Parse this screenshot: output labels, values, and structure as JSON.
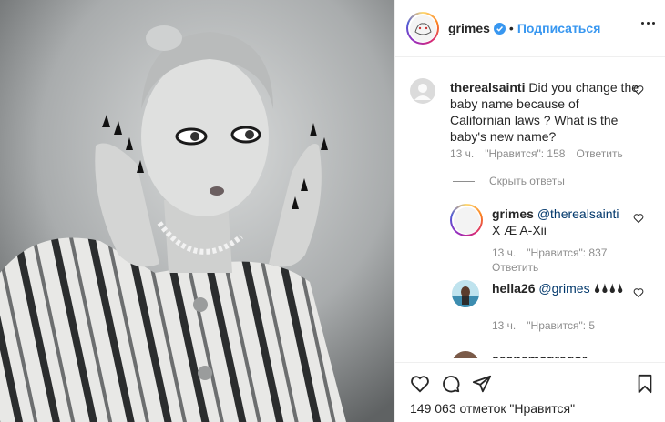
{
  "post": {
    "author": "grimes",
    "follow_label": "Подписаться",
    "separator": "•",
    "likes_text": "149 063 отметок \"Нравится\""
  },
  "comment": {
    "user": "therealsainti",
    "text": "Did you change the baby name because of Californian laws ? What is the baby's new name?",
    "time": "13 ч.",
    "likes": "\"Нравится\": 158",
    "reply": "Ответить"
  },
  "hide_replies_label": "Скрыть ответы",
  "replies": [
    {
      "user": "grimes",
      "mention": "@therealsainti",
      "text": " X Æ A-Xii",
      "time": "13 ч.",
      "likes": "\"Нравится\": 837",
      "reply": "Ответить"
    },
    {
      "user": "hella26",
      "mention": "@grimes",
      "text": " 🌢🌢🌢🌢",
      "time": "13 ч.",
      "likes": "\"Нравится\": 5"
    },
    {
      "user": "seanemcgregor"
    }
  ],
  "colors": {
    "link": "#3897f0",
    "secondary": "#8e8e8e",
    "border": "#efefef"
  },
  "icons": [
    "heart-icon",
    "comment-icon",
    "share-icon",
    "bookmark-icon",
    "verified-icon",
    "more-options-icon"
  ]
}
